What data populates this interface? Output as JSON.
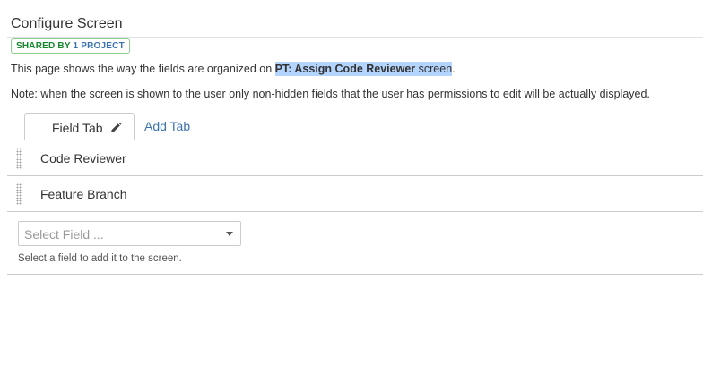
{
  "page": {
    "title": "Configure Screen",
    "badge": {
      "part1": "SHARED BY",
      "part2": "1 PROJECT",
      "colors": {
        "part1": "#14892c",
        "part2": "#3b73af"
      }
    },
    "description": {
      "prefix": "This page shows the way the fields are organized on ",
      "screen_name": "PT: Assign Code Reviewer",
      "suffix": " screen",
      "end": "."
    },
    "note": "Note: when the screen is shown to the user only non-hidden fields that the user has permissions to edit will be actually displayed."
  },
  "tabs": [
    {
      "label": "Field Tab",
      "active": true,
      "icon": "pencil-icon"
    },
    {
      "label": "Add Tab",
      "active": false
    }
  ],
  "fields": [
    {
      "name": "Code Reviewer",
      "icon": "drag-handle-icon"
    },
    {
      "name": "Feature Branch",
      "icon": "drag-handle-icon"
    }
  ],
  "add_field": {
    "placeholder": "Select Field ...",
    "help": "Select a field to add it to the screen.",
    "icon": "chevron-down-icon"
  },
  "colors": {
    "link": "#3b73af",
    "highlight": "#b3d4fc"
  }
}
